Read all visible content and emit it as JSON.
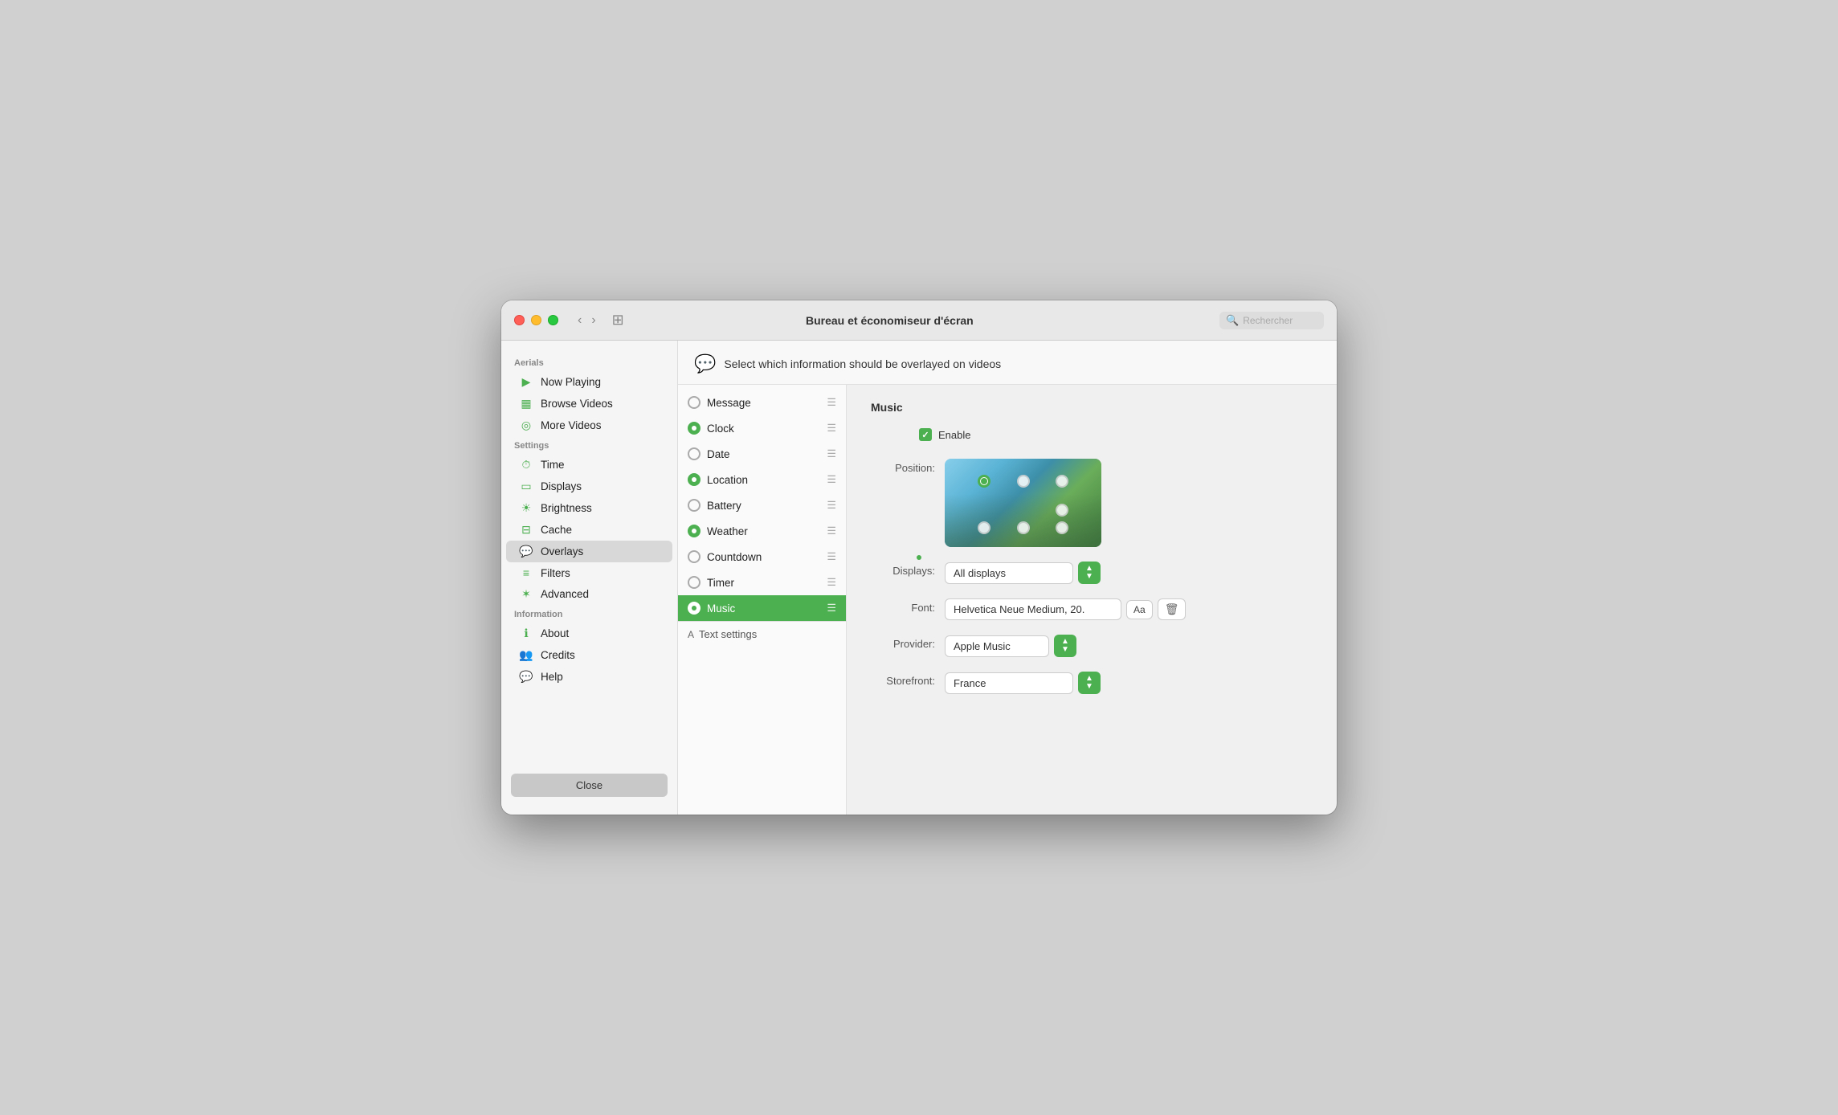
{
  "window": {
    "title": "Bureau et économiseur d'écran",
    "search_placeholder": "Rechercher"
  },
  "sidebar": {
    "aerials_label": "Aerials",
    "settings_label": "Settings",
    "information_label": "Information",
    "items": [
      {
        "id": "now-playing",
        "label": "Now Playing",
        "icon": "▶"
      },
      {
        "id": "browse-videos",
        "label": "Browse Videos",
        "icon": "▦"
      },
      {
        "id": "more-videos",
        "label": "More Videos",
        "icon": "◉"
      },
      {
        "id": "time",
        "label": "Time",
        "icon": "⏱"
      },
      {
        "id": "displays",
        "label": "Displays",
        "icon": "▭"
      },
      {
        "id": "brightness",
        "label": "Brightness",
        "icon": "☀"
      },
      {
        "id": "cache",
        "label": "Cache",
        "icon": "⊟"
      },
      {
        "id": "overlays",
        "label": "Overlays",
        "icon": "💬",
        "active": true
      },
      {
        "id": "filters",
        "label": "Filters",
        "icon": "≡"
      },
      {
        "id": "advanced",
        "label": "Advanced",
        "icon": "✶"
      },
      {
        "id": "about",
        "label": "About",
        "icon": "ℹ"
      },
      {
        "id": "credits",
        "label": "Credits",
        "icon": "👥"
      },
      {
        "id": "help",
        "label": "Help",
        "icon": "💬"
      }
    ],
    "close_label": "Close"
  },
  "header": {
    "icon": "💬",
    "title": "Select which information should be overlayed on videos"
  },
  "overlay_list": {
    "items": [
      {
        "id": "message",
        "label": "Message",
        "checked": false
      },
      {
        "id": "clock",
        "label": "Clock",
        "checked": true
      },
      {
        "id": "date",
        "label": "Date",
        "checked": false
      },
      {
        "id": "location",
        "label": "Location",
        "checked": true
      },
      {
        "id": "battery",
        "label": "Battery",
        "checked": false
      },
      {
        "id": "weather",
        "label": "Weather",
        "checked": true
      },
      {
        "id": "countdown",
        "label": "Countdown",
        "checked": false
      },
      {
        "id": "timer",
        "label": "Timer",
        "checked": false
      },
      {
        "id": "music",
        "label": "Music",
        "checked": true,
        "active": true
      }
    ],
    "text_settings_label": "Text settings"
  },
  "detail": {
    "section_title": "Music",
    "enable_label": "Enable",
    "position_label": "Position:",
    "displays_label": "Displays:",
    "displays_value": "All displays",
    "font_label": "Font:",
    "font_value": "Helvetica Neue Medium, 20.",
    "font_btn_label": "Aa",
    "provider_label": "Provider:",
    "provider_value": "Apple Music",
    "storefront_label": "Storefront:",
    "storefront_value": "France"
  }
}
